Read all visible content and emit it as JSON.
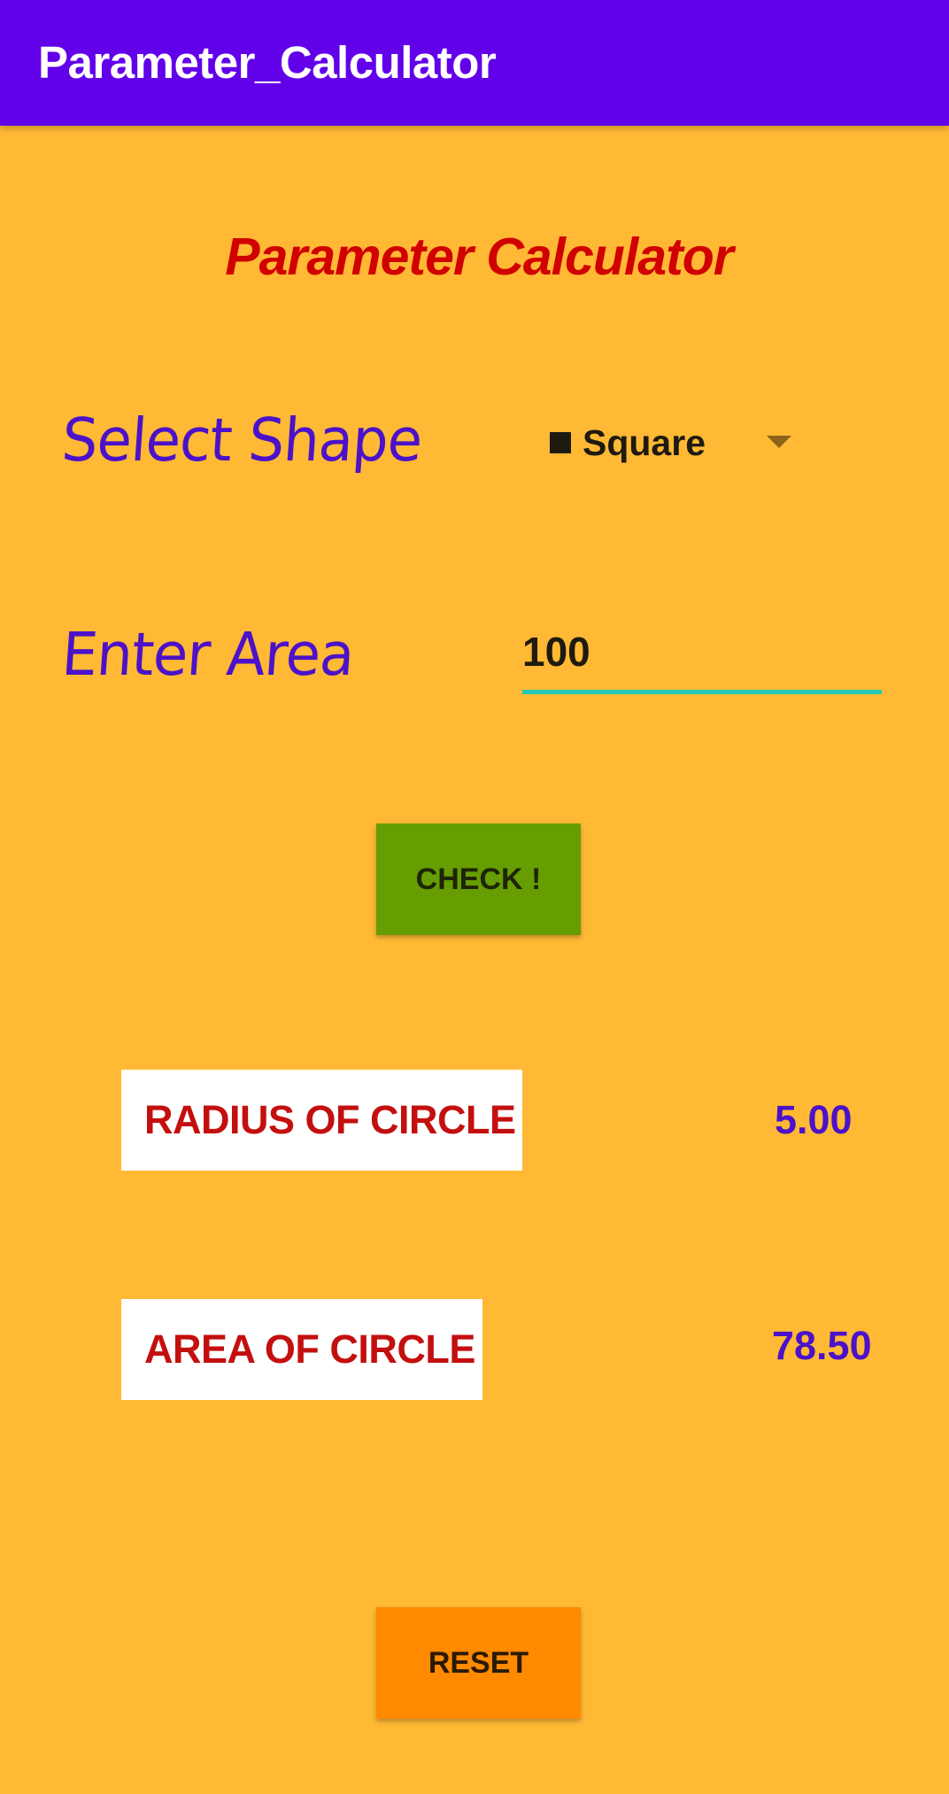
{
  "app_bar": {
    "title": "Parameter_Calculator"
  },
  "main": {
    "heading": "Parameter Calculator",
    "select_shape_label": "Select Shape",
    "shape_select": {
      "selected": "Square",
      "icon": "square-icon"
    },
    "enter_area_label": "Enter Area",
    "area_input": {
      "value": "100"
    },
    "check_button": "CHECK !",
    "results": [
      {
        "label": "RADIUS OF CIRCLE",
        "value": "5.00"
      },
      {
        "label": "AREA OF CIRCLE",
        "value": "78.50"
      }
    ],
    "reset_button": "RESET"
  },
  "colors": {
    "background": "#FFB935",
    "app_bar": "#6200EA",
    "heading": "#D10000",
    "label": "#4B12C9",
    "check_button": "#669D00",
    "reset_button": "#FF8A00",
    "input_underline": "#26C9B7",
    "result_label": "#C40F0F"
  }
}
